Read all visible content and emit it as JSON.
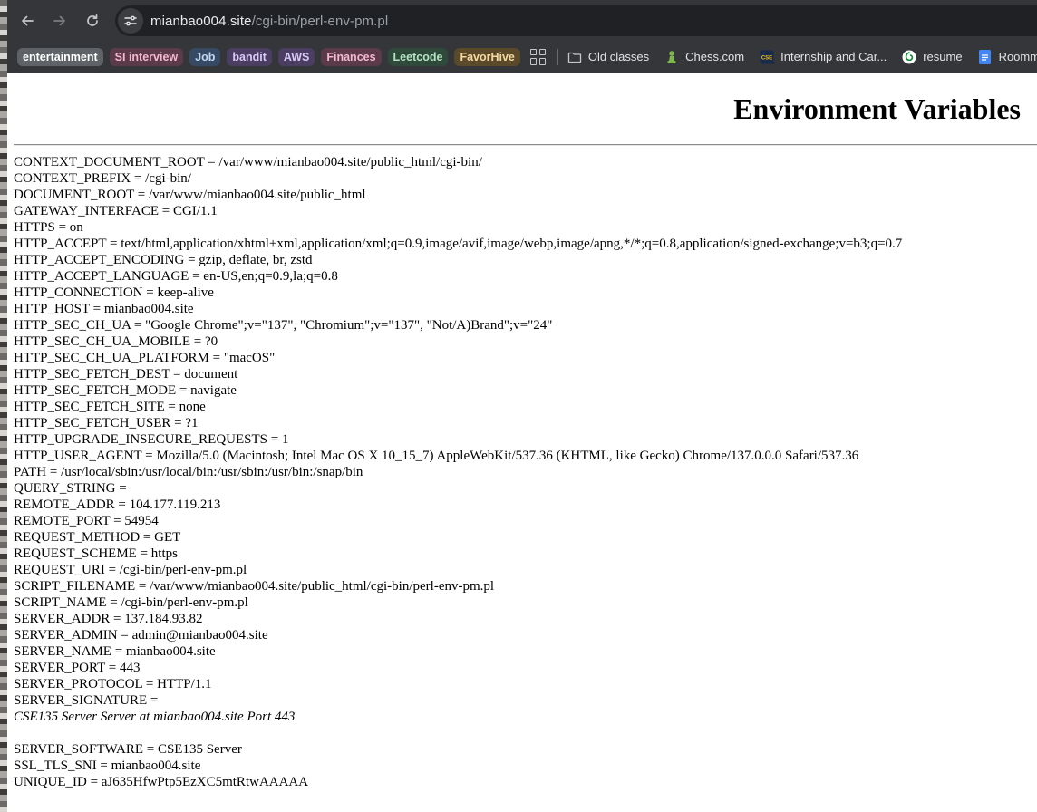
{
  "browser": {
    "url_host": "mianbao004.site",
    "url_path": "/cgi-bin/perl-env-pm.pl",
    "bookmark_chips": [
      {
        "label": "entertainment",
        "bg": "#5f6368",
        "color": "#ffffff"
      },
      {
        "label": "SI interview",
        "bg": "#5b3a4a",
        "color": "#f5b8cf"
      },
      {
        "label": "Job",
        "bg": "#364a63",
        "color": "#c2d7f3"
      },
      {
        "label": "bandit",
        "bg": "#4a3f63",
        "color": "#d8c8f7"
      },
      {
        "label": "AWS",
        "bg": "#4a3f63",
        "color": "#d8c8f7"
      },
      {
        "label": "Finances",
        "bg": "#5b3a4a",
        "color": "#f5b8cf"
      },
      {
        "label": "Leetcode",
        "bg": "#2f4a3a",
        "color": "#b5e3c3"
      },
      {
        "label": "FavorHive",
        "bg": "#5a4a2a",
        "color": "#f4d8a0"
      }
    ],
    "bookmarks": [
      {
        "label": "Old classes",
        "icon": "folder-icon"
      },
      {
        "label": "Chess.com",
        "icon": "chess-pawn-icon"
      },
      {
        "label": "Internship and Car...",
        "icon": "cse-logo-icon"
      },
      {
        "label": "resume",
        "icon": "overleaf-icon"
      },
      {
        "label": "Roomma",
        "icon": "google-docs-icon"
      }
    ]
  },
  "page": {
    "title": "Environment Variables",
    "vars": [
      "CONTEXT_DOCUMENT_ROOT = /var/www/mianbao004.site/public_html/cgi-bin/",
      "CONTEXT_PREFIX = /cgi-bin/",
      "DOCUMENT_ROOT = /var/www/mianbao004.site/public_html",
      "GATEWAY_INTERFACE = CGI/1.1",
      "HTTPS = on",
      "HTTP_ACCEPT = text/html,application/xhtml+xml,application/xml;q=0.9,image/avif,image/webp,image/apng,*/*;q=0.8,application/signed-exchange;v=b3;q=0.7",
      "HTTP_ACCEPT_ENCODING = gzip, deflate, br, zstd",
      "HTTP_ACCEPT_LANGUAGE = en-US,en;q=0.9,la;q=0.8",
      "HTTP_CONNECTION = keep-alive",
      "HTTP_HOST = mianbao004.site",
      "HTTP_SEC_CH_UA = \"Google Chrome\";v=\"137\", \"Chromium\";v=\"137\", \"Not/A)Brand\";v=\"24\"",
      "HTTP_SEC_CH_UA_MOBILE = ?0",
      "HTTP_SEC_CH_UA_PLATFORM = \"macOS\"",
      "HTTP_SEC_FETCH_DEST = document",
      "HTTP_SEC_FETCH_MODE = navigate",
      "HTTP_SEC_FETCH_SITE = none",
      "HTTP_SEC_FETCH_USER = ?1",
      "HTTP_UPGRADE_INSECURE_REQUESTS = 1",
      "HTTP_USER_AGENT = Mozilla/5.0 (Macintosh; Intel Mac OS X 10_15_7) AppleWebKit/537.36 (KHTML, like Gecko) Chrome/137.0.0.0 Safari/537.36",
      "PATH = /usr/local/sbin:/usr/local/bin:/usr/sbin:/usr/bin:/snap/bin",
      "QUERY_STRING =",
      "REMOTE_ADDR = 104.177.119.213",
      "REMOTE_PORT = 54954",
      "REQUEST_METHOD = GET",
      "REQUEST_SCHEME = https",
      "REQUEST_URI = /cgi-bin/perl-env-pm.pl",
      "SCRIPT_FILENAME = /var/www/mianbao004.site/public_html/cgi-bin/perl-env-pm.pl",
      "SCRIPT_NAME = /cgi-bin/perl-env-pm.pl",
      "SERVER_ADDR = 137.184.93.82",
      "SERVER_ADMIN = admin@mianbao004.site",
      "SERVER_NAME = mianbao004.site",
      "SERVER_PORT = 443",
      "SERVER_PROTOCOL = HTTP/1.1",
      "SERVER_SIGNATURE ="
    ],
    "signature": "CSE135 Server Server at mianbao004.site Port 443",
    "vars_after": [
      "SERVER_SOFTWARE = CSE135 Server",
      "SSL_TLS_SNI = mianbao004.site",
      "UNIQUE_ID = aJ635HfwPtp5EzXC5mtRtwAAAAA"
    ]
  }
}
